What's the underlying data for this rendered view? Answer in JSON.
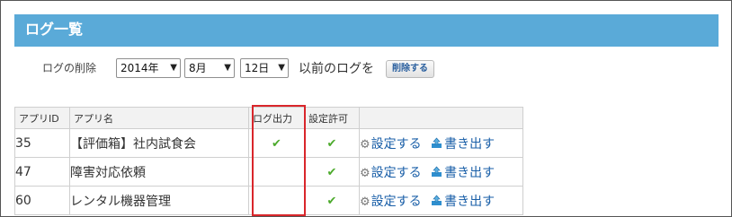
{
  "header": {
    "title": "ログ一覧"
  },
  "delete_form": {
    "label": "ログの削除",
    "year": "2014年",
    "month": "8月",
    "day": "12日",
    "after_text": "以前のログを",
    "delete_button": "削除する"
  },
  "table": {
    "headers": {
      "app_id": "アプリID",
      "app_name": "アプリ名",
      "log_output": "ログ出力",
      "setting_permission": "設定許可"
    },
    "rows": [
      {
        "id": "35",
        "name": "【評価箱】社内試食会",
        "log_output": true,
        "setting_permission": true,
        "settings_link": "設定する",
        "export_link": "書き出す"
      },
      {
        "id": "47",
        "name": "障害対応依頼",
        "log_output": false,
        "setting_permission": true,
        "settings_link": "設定する",
        "export_link": "書き出す"
      },
      {
        "id": "60",
        "name": "レンタル機器管理",
        "log_output": false,
        "setting_permission": true,
        "settings_link": "設定する",
        "export_link": "書き出す"
      }
    ]
  },
  "colors": {
    "header_bg": "#5aaad8",
    "check": "#4caa2c",
    "link": "#1a5fa8",
    "highlight": "#d9262b"
  },
  "icons": {
    "check": "check-icon",
    "gear": "gear-icon",
    "export": "export-icon"
  }
}
